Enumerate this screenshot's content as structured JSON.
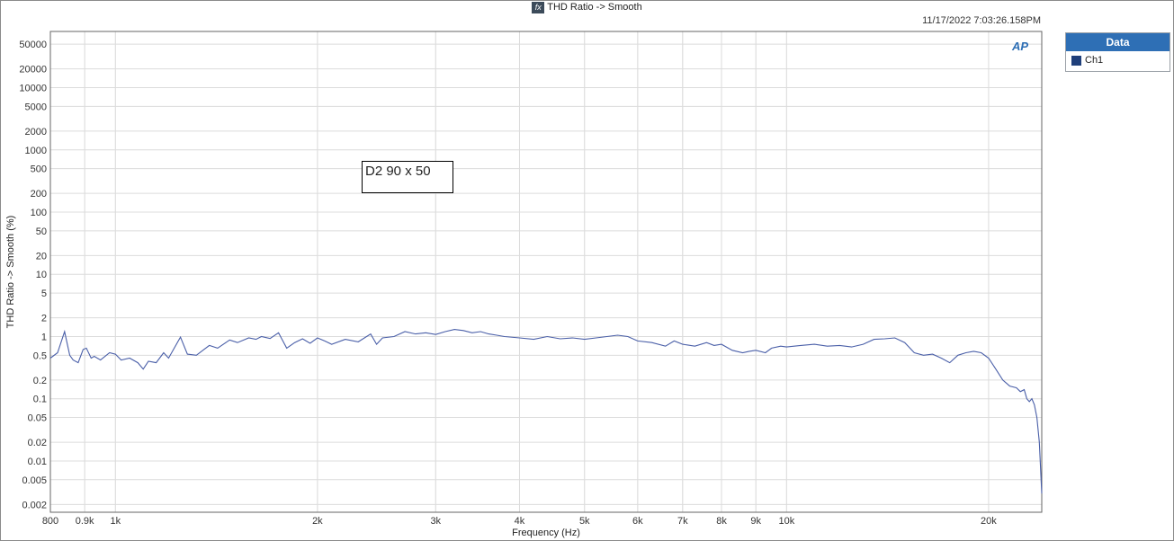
{
  "header": {
    "fx_label": "fx",
    "title": "THD Ratio -> Smooth",
    "timestamp": "11/17/2022 7:03:26.158PM",
    "logo_text": "AP"
  },
  "legend": {
    "title": "Data",
    "items": [
      {
        "label": "Ch1",
        "color": "#1f3f7a"
      }
    ]
  },
  "annotation": {
    "text": "D2 90 x 50"
  },
  "colors": {
    "trace": "#4a5fa8",
    "grid": "#dcdcdc",
    "legend_header": "#2e6fb5"
  },
  "chart_data": {
    "type": "line",
    "title": "THD Ratio -> Smooth",
    "xlabel": "Frequency (Hz)",
    "ylabel": "THD Ratio -> Smooth (%)",
    "x_scale": "log",
    "y_scale": "log",
    "xlim": [
      800,
      24000
    ],
    "ylim": [
      0.0015,
      80000
    ],
    "grid": true,
    "legend_placement": "right",
    "x_ticks": [
      {
        "v": 800,
        "label": "800"
      },
      {
        "v": 900,
        "label": "0.9k"
      },
      {
        "v": 1000,
        "label": "1k"
      },
      {
        "v": 2000,
        "label": "2k"
      },
      {
        "v": 3000,
        "label": "3k"
      },
      {
        "v": 4000,
        "label": "4k"
      },
      {
        "v": 5000,
        "label": "5k"
      },
      {
        "v": 6000,
        "label": "6k"
      },
      {
        "v": 7000,
        "label": "7k"
      },
      {
        "v": 8000,
        "label": "8k"
      },
      {
        "v": 9000,
        "label": "9k"
      },
      {
        "v": 10000,
        "label": "10k"
      },
      {
        "v": 20000,
        "label": "20k"
      }
    ],
    "y_ticks": [
      {
        "v": 50000,
        "label": "50000"
      },
      {
        "v": 20000,
        "label": "20000"
      },
      {
        "v": 10000,
        "label": "10000"
      },
      {
        "v": 5000,
        "label": "5000"
      },
      {
        "v": 2000,
        "label": "2000"
      },
      {
        "v": 1000,
        "label": "1000"
      },
      {
        "v": 500,
        "label": "500"
      },
      {
        "v": 200,
        "label": "200"
      },
      {
        "v": 100,
        "label": "100"
      },
      {
        "v": 50,
        "label": "50"
      },
      {
        "v": 20,
        "label": "20"
      },
      {
        "v": 10,
        "label": "10"
      },
      {
        "v": 5,
        "label": "5"
      },
      {
        "v": 2,
        "label": "2"
      },
      {
        "v": 1,
        "label": "1"
      },
      {
        "v": 0.5,
        "label": "0.5"
      },
      {
        "v": 0.2,
        "label": "0.2"
      },
      {
        "v": 0.1,
        "label": "0.1"
      },
      {
        "v": 0.05,
        "label": "0.05"
      },
      {
        "v": 0.02,
        "label": "0.02"
      },
      {
        "v": 0.01,
        "label": "0.01"
      },
      {
        "v": 0.005,
        "label": "0.005"
      },
      {
        "v": 0.002,
        "label": "0.002"
      }
    ],
    "series": [
      {
        "name": "Ch1",
        "x": [
          800,
          820,
          840,
          855,
          865,
          880,
          895,
          905,
          920,
          930,
          950,
          980,
          1000,
          1020,
          1050,
          1080,
          1100,
          1120,
          1150,
          1180,
          1200,
          1250,
          1280,
          1320,
          1350,
          1380,
          1420,
          1480,
          1520,
          1580,
          1620,
          1650,
          1700,
          1750,
          1800,
          1850,
          1900,
          1950,
          2000,
          2050,
          2100,
          2200,
          2300,
          2400,
          2450,
          2500,
          2600,
          2700,
          2800,
          2900,
          3000,
          3100,
          3200,
          3300,
          3400,
          3500,
          3600,
          3700,
          3800,
          4000,
          4200,
          4400,
          4600,
          4800,
          5000,
          5200,
          5400,
          5600,
          5800,
          6000,
          6300,
          6600,
          6800,
          7000,
          7300,
          7600,
          7800,
          8000,
          8300,
          8600,
          8800,
          9000,
          9300,
          9500,
          9800,
          10000,
          10500,
          11000,
          11500,
          12000,
          12500,
          13000,
          13500,
          14000,
          14500,
          15000,
          15500,
          16000,
          16500,
          17000,
          17500,
          18000,
          18500,
          19000,
          19500,
          20000,
          20500,
          21000,
          21500,
          22000,
          22300,
          22600,
          22800,
          23000,
          23200,
          23400,
          23600,
          23800,
          24000
        ],
        "y": [
          0.45,
          0.55,
          1.2,
          0.5,
          0.42,
          0.38,
          0.62,
          0.65,
          0.45,
          0.48,
          0.42,
          0.55,
          0.52,
          0.42,
          0.45,
          0.38,
          0.3,
          0.4,
          0.38,
          0.55,
          0.45,
          0.98,
          0.52,
          0.5,
          0.6,
          0.72,
          0.65,
          0.88,
          0.8,
          0.95,
          0.9,
          1.0,
          0.93,
          1.15,
          0.65,
          0.8,
          0.92,
          0.78,
          0.95,
          0.85,
          0.75,
          0.9,
          0.82,
          1.1,
          0.75,
          0.95,
          1.0,
          1.2,
          1.1,
          1.15,
          1.08,
          1.2,
          1.3,
          1.25,
          1.15,
          1.2,
          1.1,
          1.05,
          1.0,
          0.95,
          0.9,
          1.0,
          0.92,
          0.95,
          0.9,
          0.95,
          1.0,
          1.05,
          1.0,
          0.85,
          0.8,
          0.7,
          0.85,
          0.75,
          0.7,
          0.8,
          0.72,
          0.75,
          0.6,
          0.55,
          0.58,
          0.6,
          0.55,
          0.65,
          0.7,
          0.68,
          0.72,
          0.75,
          0.7,
          0.72,
          0.68,
          0.75,
          0.9,
          0.92,
          0.95,
          0.8,
          0.55,
          0.5,
          0.52,
          0.45,
          0.38,
          0.5,
          0.55,
          0.58,
          0.55,
          0.45,
          0.3,
          0.2,
          0.16,
          0.15,
          0.13,
          0.14,
          0.1,
          0.09,
          0.1,
          0.08,
          0.05,
          0.02,
          0.003
        ]
      }
    ]
  }
}
